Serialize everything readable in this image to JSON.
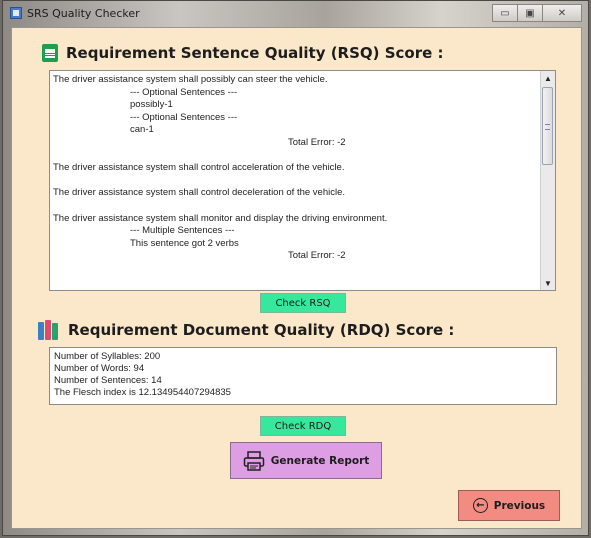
{
  "window": {
    "title": "SRS Quality Checker",
    "buttons": {
      "minimize": "▭",
      "maximize": "▣",
      "close": "✕"
    }
  },
  "rsq": {
    "title": "Requirement Sentence Quality (RSQ) Score :",
    "icon": "spreadsheet-icon",
    "lines": [
      {
        "text": "The driver assistance system shall possibly can steer the vehicle.",
        "indent": "none"
      },
      {
        "text": "--- Optional Sentences ---",
        "indent": "sub"
      },
      {
        "text": "possibly-1",
        "indent": "sub"
      },
      {
        "text": "--- Optional Sentences ---",
        "indent": "sub"
      },
      {
        "text": "can-1",
        "indent": "sub"
      },
      {
        "text": "Total Error: -2",
        "indent": "total"
      },
      {
        "text": "",
        "indent": "gap"
      },
      {
        "text": "The driver assistance system shall control acceleration of the vehicle.",
        "indent": "none"
      },
      {
        "text": "",
        "indent": "gap"
      },
      {
        "text": "The driver assistance system shall control deceleration of the vehicle.",
        "indent": "none"
      },
      {
        "text": "",
        "indent": "gap"
      },
      {
        "text": "The driver assistance system shall monitor and display the driving environment.",
        "indent": "none"
      },
      {
        "text": "--- Multiple Sentences ---",
        "indent": "sub"
      },
      {
        "text": "This sentence got 2 verbs",
        "indent": "sub"
      },
      {
        "text": "Total Error: -2",
        "indent": "total"
      }
    ],
    "button": "Check RSQ"
  },
  "rdq": {
    "title": "Requirement Document Quality (RDQ) Score :",
    "icon": "books-icon",
    "lines": [
      "Number of Syllables: 200",
      "Number of Words: 94",
      "Number of Sentences: 14",
      "The Flesch index is 12.134954407294835"
    ],
    "button": "Check RDQ"
  },
  "actions": {
    "generate_report": "Generate Report",
    "generate_icon": "printer-icon",
    "previous": "Previous",
    "previous_icon": "back-arrow-icon"
  },
  "colors": {
    "background": "#fbe7c9",
    "check_button": "#35e89c",
    "report_button": "#dd9ee4",
    "previous_button": "#f28b82"
  }
}
